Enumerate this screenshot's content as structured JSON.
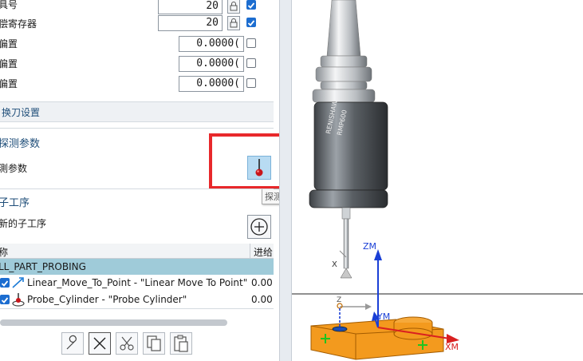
{
  "panel": {
    "rows": [
      {
        "label": "具号",
        "value": "20"
      },
      {
        "label": "偿寄存器",
        "value": "20"
      },
      {
        "label": "偏置",
        "value": "0.0000("
      },
      {
        "label": "偏置",
        "value": "0.0000("
      },
      {
        "label": "偏置",
        "value": "0.0000("
      }
    ],
    "tool_change_section": "换刀设置",
    "probe_section": {
      "title": "探测参数",
      "row_label": "測参数",
      "tooltip": "探测参数"
    },
    "subop_section": {
      "title": "子工序",
      "row_label": "新的子工序"
    },
    "table": {
      "col_name": "称",
      "col_feed": "进给",
      "group": "LL_PART_PROBING",
      "items": [
        {
          "name": "Linear_Move_To_Point - \"Linear Move To Point\"",
          "value": "0.00"
        },
        {
          "name": "Probe_Cylinder - \"Probe Cylinder\"",
          "value": "0.00"
        }
      ]
    }
  },
  "viewport": {
    "axes": {
      "zm": "ZM",
      "ym": "YM",
      "xm": "XM",
      "x": "X",
      "z": "Z"
    },
    "probe_text": [
      "RENISHAW",
      "RMP600"
    ],
    "colors": {
      "axis_blue": "#1a3fd6",
      "axis_red": "#d92020",
      "part_orange": "#f39a1e",
      "marker_green": "#1fc41f"
    }
  },
  "colors": {
    "selection": "#9fcbd9",
    "checkbox_on": "#1c6dd0",
    "highlight": "#e8282b"
  }
}
